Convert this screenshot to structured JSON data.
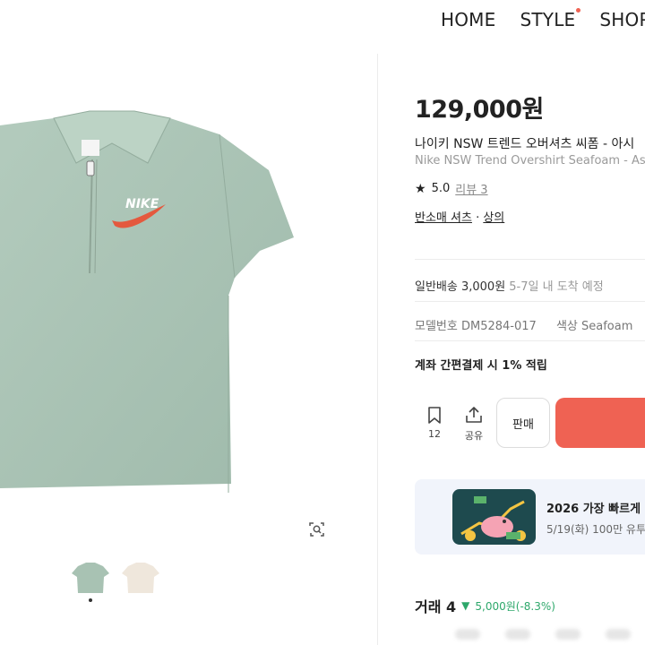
{
  "nav": {
    "items": [
      "HOME",
      "STYLE",
      "SHOP"
    ]
  },
  "product": {
    "price": "129,000원",
    "title_ko": "나이키 NSW 트렌드 오버셔츠 씨폼 - 아시",
    "title_en": "Nike NSW Trend Overshirt Seafoam - Asia",
    "rating": "5.0",
    "review_label": "리뷰 3",
    "category_1": "반소매 셔츠",
    "category_sep": " · ",
    "category_2": "상의"
  },
  "shipping": {
    "main": "일반배송 3,000원",
    "eta": " 5-7일 내 도착 예정"
  },
  "model": {
    "label": "모델번호",
    "value": "DM5284-017",
    "color_label": "색상",
    "color_value": "Seafoam"
  },
  "point": "계좌 간편결제 시 1% 적립",
  "actions": {
    "bookmark_count": "12",
    "share_label": "공유",
    "sell_label": "판매"
  },
  "banner": {
    "title": "2026 가장 빠르게",
    "subtitle": "5/19(화) 100만 유투"
  },
  "trade": {
    "label": "거래 4",
    "change": "5,000원(-8.3%)"
  },
  "colors": {
    "accent": "#ef6253",
    "seafoam": "#a7c2b3",
    "down": "#2ea86b"
  },
  "icons": [
    "bookmark-icon",
    "share-icon",
    "lens-search-icon",
    "star-icon",
    "down-triangle-icon"
  ]
}
